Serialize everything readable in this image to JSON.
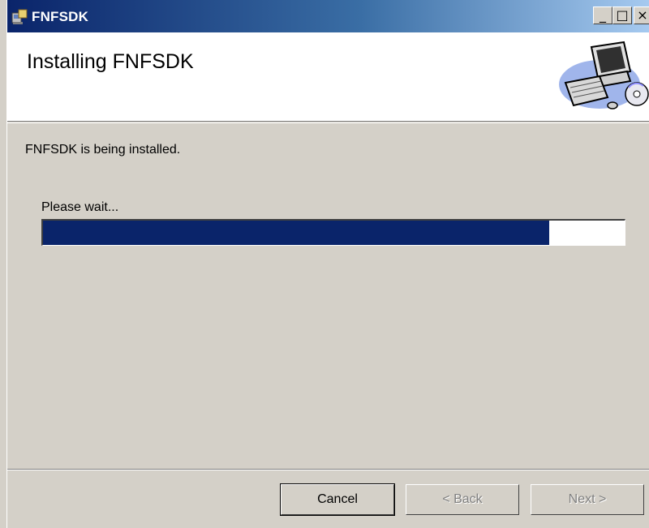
{
  "window": {
    "title": "FNFSDK",
    "minimize_glyph": "_",
    "maximize_glyph": "□",
    "close_glyph": "×"
  },
  "header": {
    "title": "Installing FNFSDK",
    "art_icon": "computer-setup-icon"
  },
  "body": {
    "status_text": "FNFSDK is being installed.",
    "wait_text": "Please wait...",
    "progress": 0.87
  },
  "buttons": {
    "cancel": "Cancel",
    "back": "< Back",
    "next": "Next >"
  },
  "colors": {
    "progress_fill": "#0a246a",
    "title_bar": "#0a246a"
  }
}
